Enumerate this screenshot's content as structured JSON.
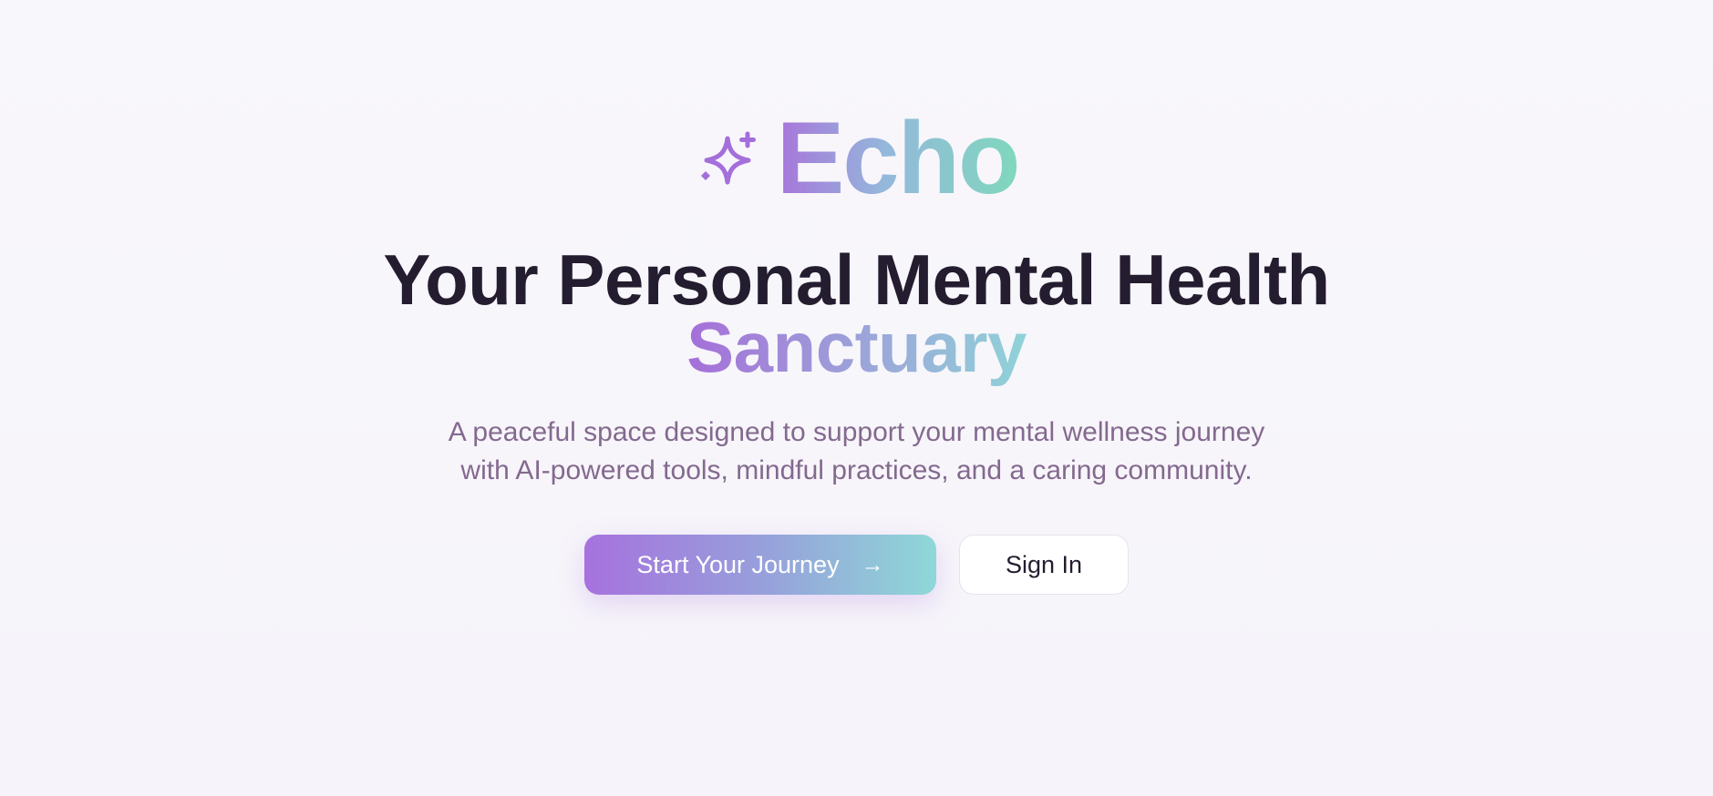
{
  "brand": {
    "name": "Echo",
    "icon": "sparkle-icon"
  },
  "hero": {
    "headline_main": "Your Personal Mental Health",
    "headline_accent": "Sanctuary",
    "subtitle_line1": "A peaceful space designed to support your mental wellness journey",
    "subtitle_line2": "with AI-powered tools, mindful practices, and a caring community."
  },
  "actions": {
    "primary_label": "Start Your Journey",
    "primary_icon": "arrow-right-icon",
    "secondary_label": "Sign In"
  },
  "colors": {
    "background": "#f7f6fa",
    "headline": "#241c2f",
    "subtitle": "#84698f",
    "gradient_start": "#a672de",
    "gradient_end": "#7fd8bd"
  }
}
